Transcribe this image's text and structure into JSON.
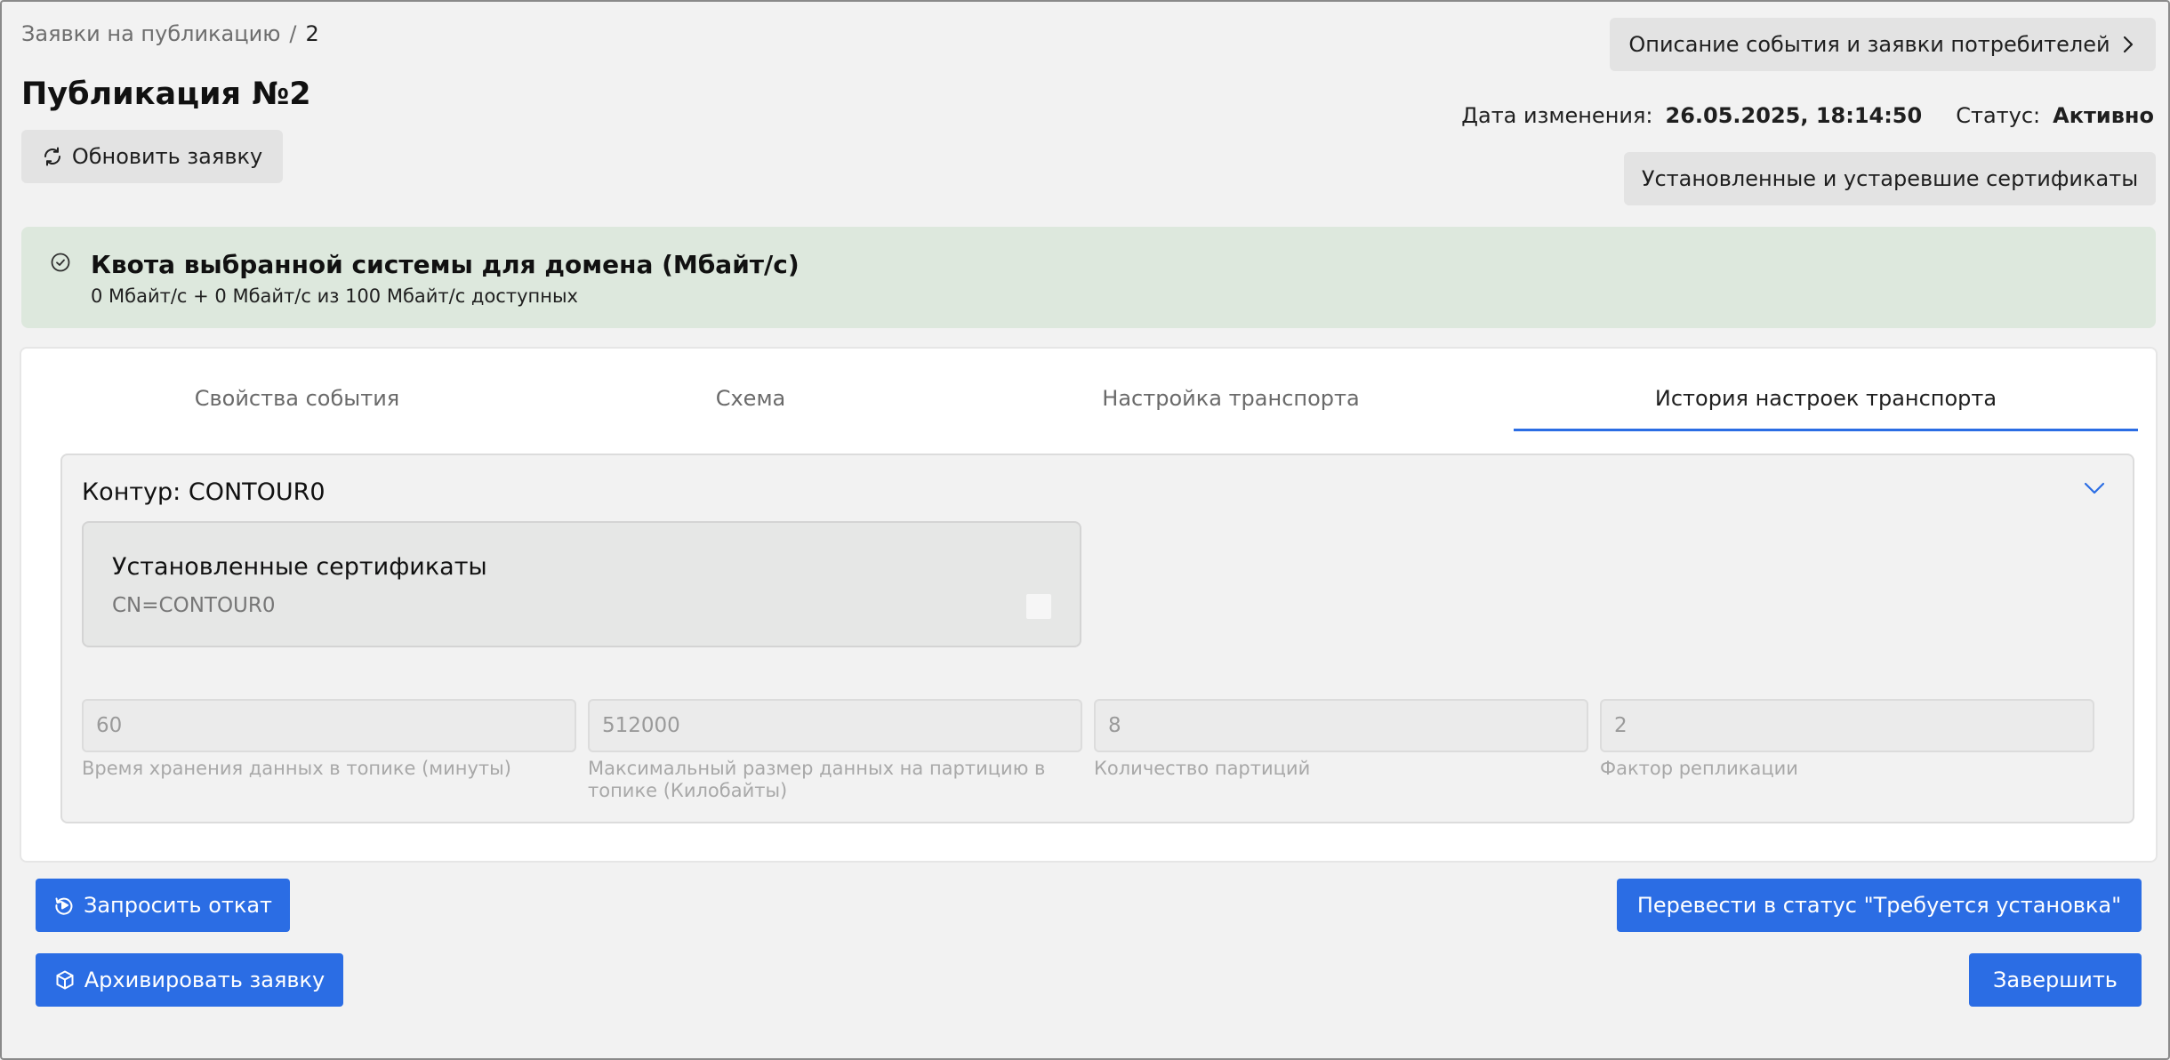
{
  "breadcrumb": {
    "parent": "Заявки на публикацию",
    "separator": "/",
    "current": "2"
  },
  "page_title": "Публикация №2",
  "refresh_button": "Обновить заявку",
  "description_button": "Описание события и заявки потребителей",
  "certificates_button": "Установленные и устаревшие сертификаты",
  "meta": {
    "changed_label": "Дата изменения:",
    "changed_value": "26.05.2025, 18:14:50",
    "status_label": "Статус:",
    "status_value": "Активно"
  },
  "quota": {
    "title": "Квота выбранной системы для домена (Мбайт/с)",
    "subtitle": "0 Мбайт/с + 0 Мбайт/с из 100 Мбайт/с доступных"
  },
  "tabs": [
    {
      "label": "Свойства события"
    },
    {
      "label": "Схема"
    },
    {
      "label": "Настройка транспорта"
    },
    {
      "label": "История настроек транспорта",
      "active": true
    }
  ],
  "contour": {
    "title": "Контур: CONTOUR0",
    "certificates": {
      "title": "Установленные сертификаты",
      "value": "CN=CONTOUR0"
    },
    "fields": [
      {
        "value": "60",
        "label": "Время хранения данных в топике (минуты)"
      },
      {
        "value": "512000",
        "label": "Максимальный размер данных на партицию в топике (Килобайты)"
      },
      {
        "value": "8",
        "label": "Количество партиций"
      },
      {
        "value": "2",
        "label": "Фактор репликации"
      }
    ]
  },
  "actions": {
    "rollback": "Запросить откат",
    "archive": "Архивировать заявку",
    "to_install": "Перевести в статус \"Требуется установка\"",
    "finish": "Завершить"
  },
  "colors": {
    "accent": "#2b6de4",
    "quota_bg": "#dde8dd",
    "page_bg": "#f2f2f2"
  },
  "icons": {
    "refresh": "refresh-icon",
    "chevron_right": "chevron-right-icon",
    "check_circle": "check-circle-icon",
    "chevron_down": "chevron-down-icon",
    "rollback": "rollback-icon",
    "archive": "archive-icon"
  }
}
